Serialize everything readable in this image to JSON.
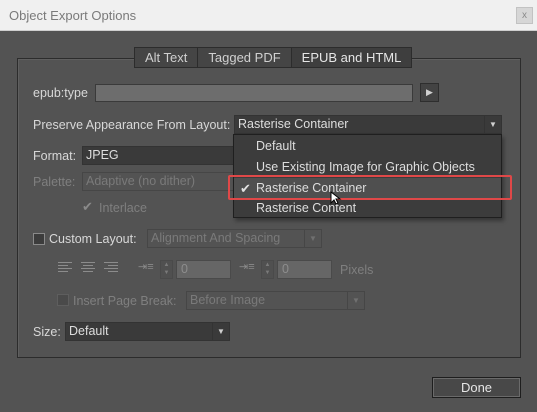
{
  "window": {
    "title": "Object Export Options",
    "close_glyph": "x"
  },
  "tabs": [
    {
      "label": "Alt Text",
      "active": false
    },
    {
      "label": "Tagged PDF",
      "active": false
    },
    {
      "label": "EPUB and HTML",
      "active": true
    }
  ],
  "epub_type": {
    "label": "epub:type",
    "value": "",
    "arrow_glyph": "▶"
  },
  "preserve": {
    "label": "Preserve Appearance From Layout:",
    "value": "Rasterise Container"
  },
  "dropdown": {
    "options": [
      "Default",
      "Use Existing Image for Graphic Objects",
      "Rasterise Container",
      "Rasterise Content"
    ],
    "selected_index": 2,
    "check_glyph": "✔"
  },
  "format": {
    "label": "Format:",
    "value": "JPEG"
  },
  "palette": {
    "label": "Palette:",
    "value": "Adaptive (no dither)"
  },
  "interlace": {
    "label": "Interlace",
    "checked": true
  },
  "custom_layout": {
    "label": "Custom Layout:",
    "checked": false,
    "value": "Alignment And Spacing"
  },
  "spacing": {
    "before_value": "0",
    "after_value": "0",
    "unit": "Pixels"
  },
  "page_break": {
    "label": "Insert Page Break:",
    "checked": false,
    "value": "Before Image"
  },
  "size": {
    "label": "Size:",
    "value": "Default"
  },
  "buttons": {
    "done": "Done"
  },
  "colors": {
    "highlight": "#e04848",
    "background": "#535353"
  }
}
